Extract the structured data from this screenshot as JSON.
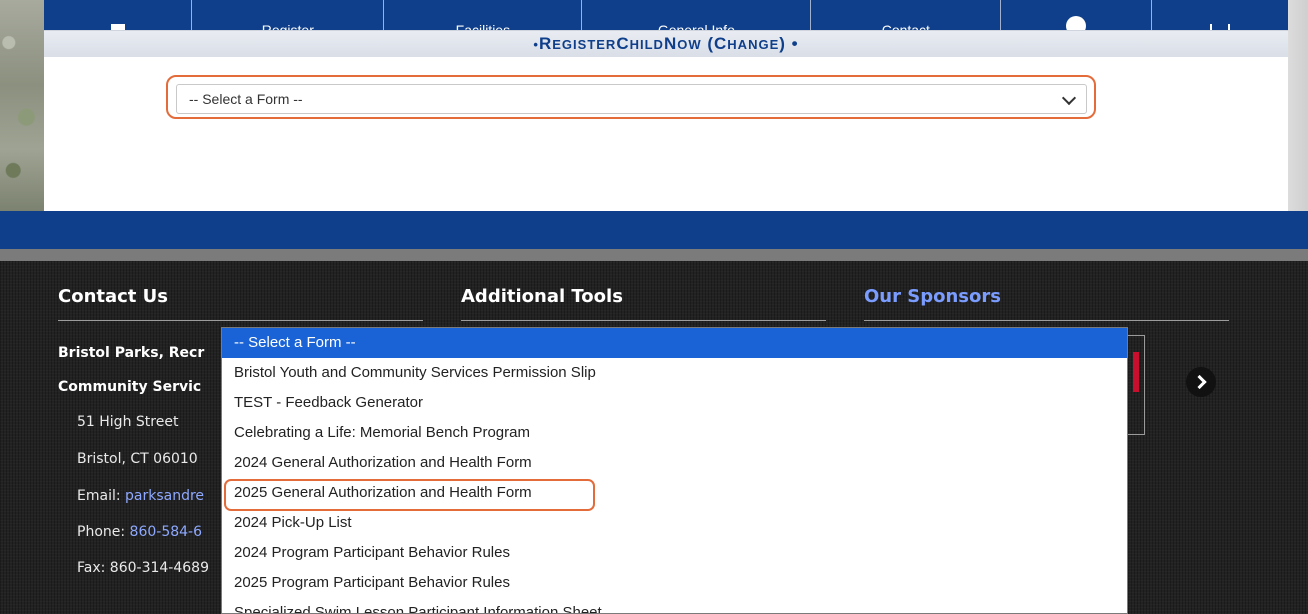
{
  "nav": {
    "items": [
      {
        "label": "",
        "icon": "home-icon"
      },
      {
        "label": "Register"
      },
      {
        "label": "Facilities"
      },
      {
        "label": "General Info"
      },
      {
        "label": "Contact"
      },
      {
        "label": "",
        "icon": "globe-icon"
      },
      {
        "label": "",
        "icon": "cart-icon"
      }
    ]
  },
  "banner": {
    "prefix": "• ",
    "r": "R",
    "egister": "EGISTER",
    "space1": " ",
    "c": "C",
    "hild": "HILD",
    "space2": " ",
    "n": "N",
    "ow": "OW",
    "open": " (",
    "c2": "C",
    "hange": "HANGE",
    "close": ") •"
  },
  "form_select": {
    "value": "-- Select a Form --"
  },
  "footer": {
    "contact_title": "Contact Us",
    "tools_title": "Additional Tools",
    "sponsors_title": "Our Sponsors",
    "org_line1": "Bristol Parks, Recr",
    "org_line2": "Community Servic",
    "address1": "51 High Street",
    "address2": "Bristol, CT 06010",
    "email_label": "Email: ",
    "email_value": "parksandre",
    "phone_label": "Phone: ",
    "phone_value": "860-584-6",
    "fax": "Fax: 860-314-4689"
  },
  "dropdown": {
    "options": [
      "-- Select a Form --",
      "Bristol Youth and Community Services Permission Slip",
      "TEST - Feedback Generator",
      "Celebrating a Life: Memorial Bench Program",
      "2024 General Authorization and Health Form",
      "2025 General Authorization and Health Form",
      "2024 Pick-Up List",
      "2024 Program Participant Behavior Rules",
      "2025 Program Participant Behavior Rules",
      "Specialized Swim Lesson Participant Information Sheet"
    ],
    "selected_index": 0,
    "highlighted_index": 5
  },
  "colors": {
    "brand_blue": "#0f3f8a",
    "highlight_outline": "#e36c3a",
    "selected_option": "#1a63d6"
  }
}
